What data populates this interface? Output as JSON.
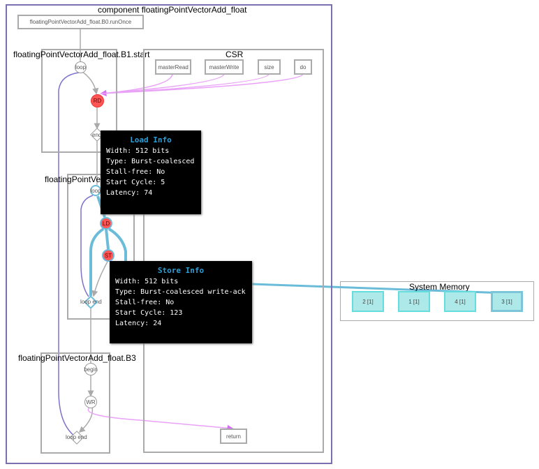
{
  "component": {
    "title": "component floatingPointVectorAdd_float"
  },
  "blocks": {
    "b0": "floatingPointVectorAdd_float.B0.runOnce",
    "b1": "floatingPointVectorAdd_float.B1.start",
    "b2": "floatingPointVec",
    "b3": "floatingPointVectorAdd_float.B3"
  },
  "csr": {
    "title": "CSR",
    "ports": [
      "masterRead",
      "masterWrite",
      "size",
      "do"
    ],
    "return": "return"
  },
  "nodes": {
    "b1_loop": "loop",
    "rd": "RD",
    "b1_end": "end",
    "b2_loop": "loop",
    "ld": "LD",
    "st": "ST",
    "b2_loop_end": "loop end",
    "begin": "begin",
    "wr": "WR",
    "b3_loop_end": "loop end"
  },
  "load_info": {
    "title": "Load Info",
    "lines": [
      {
        "k": "Width:",
        "v": "512 bits"
      },
      {
        "k": "Type:",
        "v": "Burst-coalesced"
      },
      {
        "k": "Stall-free:",
        "v": "No"
      },
      {
        "k": "Start Cycle:",
        "v": "5"
      },
      {
        "k": "Latency:",
        "v": "74"
      }
    ]
  },
  "store_info": {
    "title": "Store Info",
    "lines": [
      {
        "k": "Width:",
        "v": "512 bits"
      },
      {
        "k": "Type:",
        "v": "Burst-coalesced write-ack"
      },
      {
        "k": "Stall-free:",
        "v": "No"
      },
      {
        "k": "Start Cycle:",
        "v": "123"
      },
      {
        "k": "Latency:",
        "v": "24"
      }
    ]
  },
  "system_memory": {
    "title": "System Memory",
    "banks": [
      "2 [1]",
      "1 [1]",
      "4 [1]",
      "3 [1]"
    ]
  },
  "colors": {
    "component_border": "#7a6fb0",
    "csr_edge": "#e07ef5",
    "memory_edge": "#6bbcd8",
    "loop_back": "#7b72c9",
    "node_red": "#ff5555",
    "tip_title": "#2e9fd6"
  }
}
